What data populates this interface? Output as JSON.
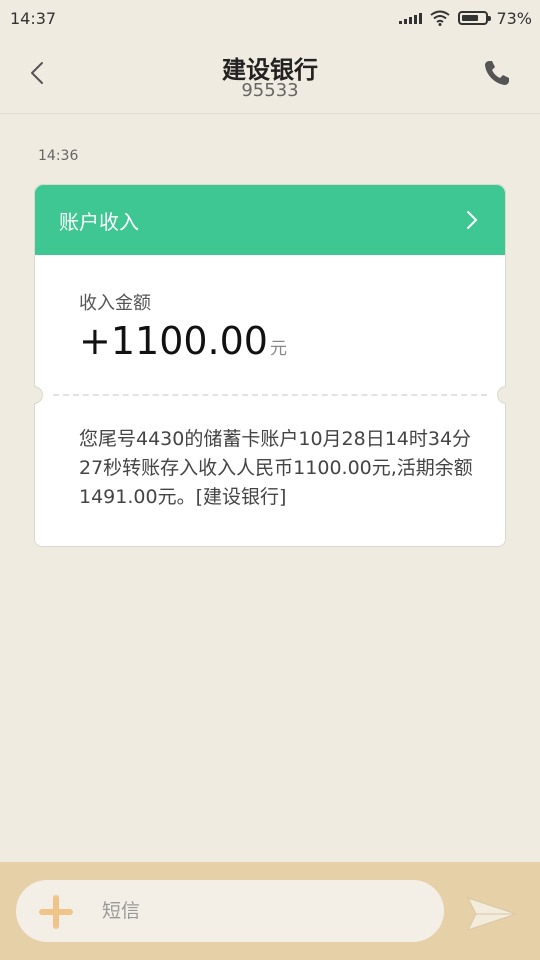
{
  "status_bar": {
    "time": "14:37",
    "battery": "73%",
    "battery_level": 0.73
  },
  "header": {
    "title": "建设银行",
    "subtitle": "95533"
  },
  "conversation": {
    "timestamp": "14:36",
    "card": {
      "header_label": "账户收入",
      "amount_label": "收入金额",
      "amount": "+1100.00",
      "amount_unit": "元",
      "message": "您尾号4430的储蓄卡账户10月28日14时34分27秒转账存入收入人民币1100.00元,活期余额1491.00元。[建设银行]"
    }
  },
  "composer": {
    "placeholder": "短信"
  },
  "colors": {
    "accent": "#3ec793",
    "background": "#f0ebe1",
    "composer_bar": "#e6d0a8",
    "plus": "#f1c48a"
  },
  "icons": [
    "signal-icon",
    "wifi-icon",
    "battery-icon",
    "back-arrow-icon",
    "phone-icon",
    "chevron-right-icon",
    "plus-icon",
    "send-icon"
  ]
}
